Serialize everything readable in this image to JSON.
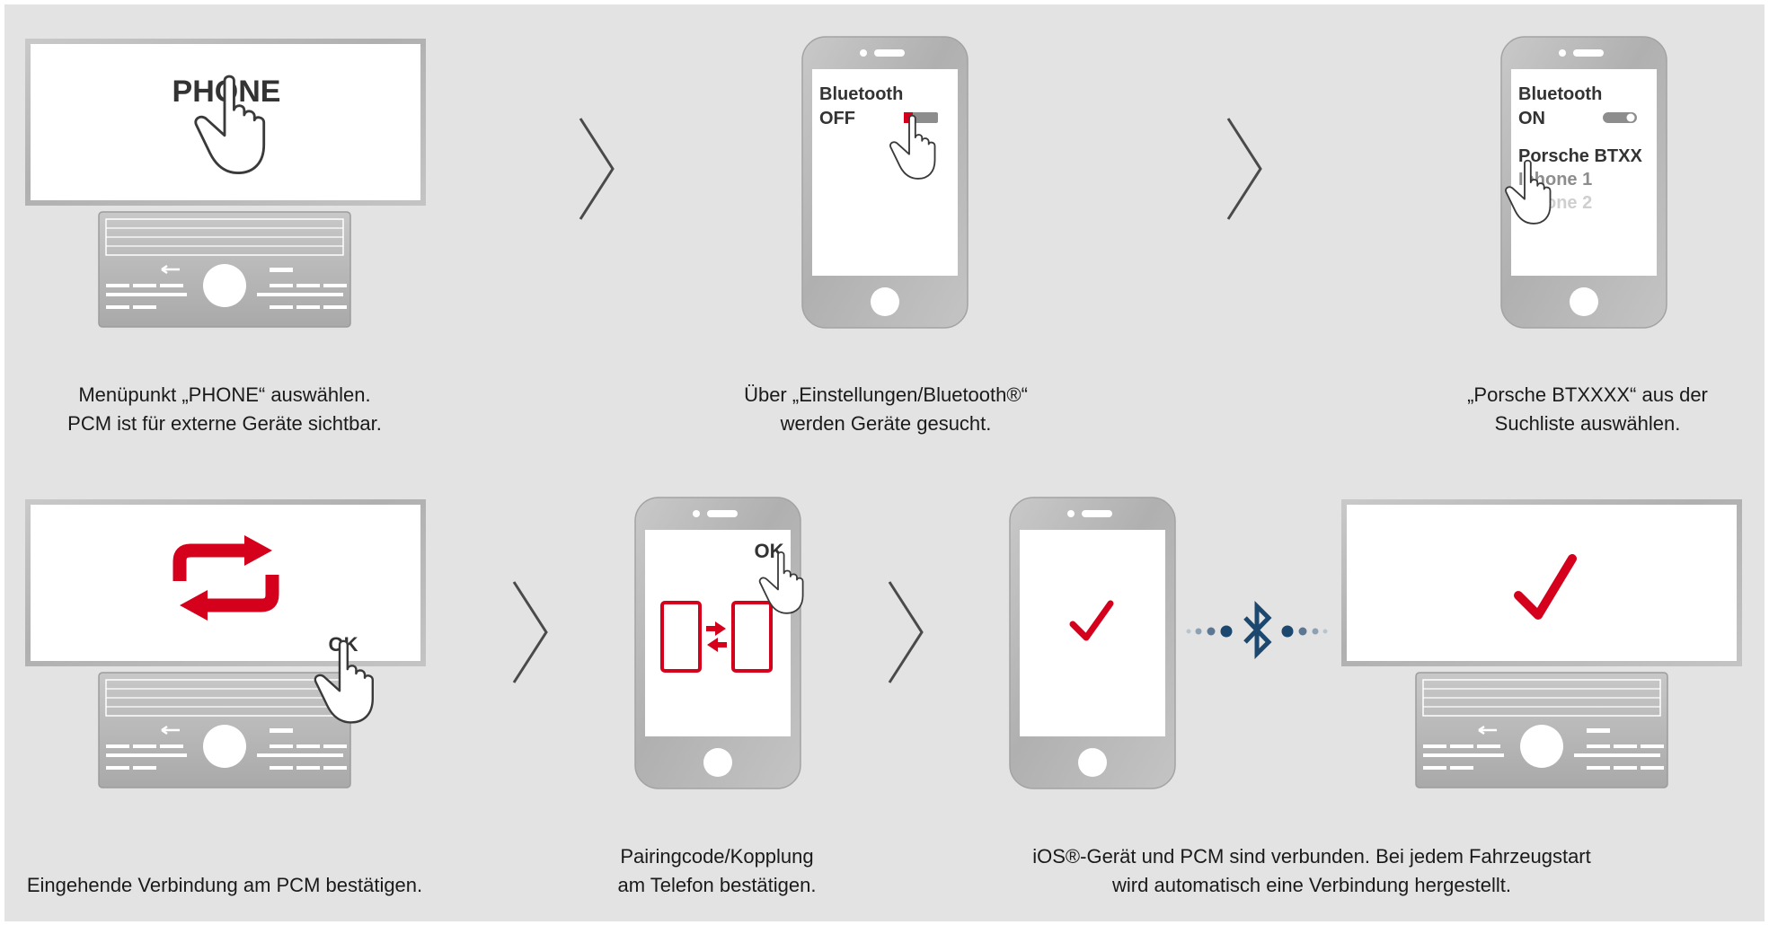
{
  "colors": {
    "background": "#e3e3e3",
    "accent_red": "#d5001c",
    "bluetooth_blue": "#1c4870",
    "text": "#1a1a1a"
  },
  "row1": {
    "step1": {
      "screen_text": "PHONE",
      "caption": [
        "Menüpunkt „PHONE“ auswählen.",
        "PCM ist für externe Geräte sichtbar."
      ]
    },
    "step2": {
      "bt_title": "Bluetooth",
      "bt_state": "OFF",
      "caption": [
        "Über „Einstellungen/Bluetooth®“",
        "werden Geräte gesucht."
      ]
    },
    "step3": {
      "bt_title": "Bluetooth",
      "bt_state": "ON",
      "device_1": "Porsche BTXX",
      "device_2": "Iphone 1",
      "device_3": "Iphone 2",
      "caption": [
        "„Porsche BTXXXX“ aus der",
        "Suchliste auswählen."
      ]
    }
  },
  "row2": {
    "step4": {
      "ok_label": "OK",
      "caption": [
        "Eingehende Verbindung am PCM bestätigen."
      ]
    },
    "step5": {
      "ok_label": "OK",
      "caption": [
        "Pairingcode/Kopplung",
        "am Telefon bestätigen."
      ]
    },
    "step6": {
      "caption": [
        "iOS®-Gerät und PCM sind verbunden. Bei jedem Fahrzeugstart",
        "wird automatisch eine Verbindung hergestellt."
      ]
    }
  },
  "icons": [
    "pcm-unit-icon",
    "smartphone-icon",
    "pointing-hand-icon",
    "chevron-right-icon",
    "sync-arrows-icon",
    "checkmark-icon",
    "bluetooth-icon",
    "pairing-icon"
  ]
}
